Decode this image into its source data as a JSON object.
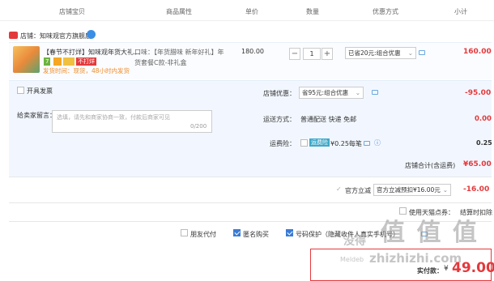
{
  "header": {
    "col_shop_item": "店铺宝贝",
    "col_attrs": "商品属性",
    "col_price": "单价",
    "col_qty": "数量",
    "col_discount": "优惠方式",
    "col_subtotal": "小计"
  },
  "shop": {
    "name": "店铺：知味观官方旗舰店"
  },
  "item": {
    "title": "【春节不打烊】知味观年货大礼...",
    "tag_7": "7",
    "tag_no_close": "不打烊",
    "ship_time": "发货时间：现货，48小时内发货",
    "attr_line1": "口味：【年货腊味 新年好礼】年",
    "attr_line2": "货套餐C款-非礼盒",
    "price": "180.00",
    "qty_minus": "−",
    "qty_value": "1",
    "qty_plus": "+",
    "discount_select": "已省20元:组合优惠",
    "subtotal": "160.00"
  },
  "panel": {
    "invoice_label": "开具发票",
    "shop_discount_label": "店铺优惠：",
    "shop_discount_select": "省95元:组合优惠",
    "shop_discount_value": "-95.00",
    "message_label": "给卖家留言：",
    "message_placeholder": "选填，请先和商家协商一致，付款后商家可见",
    "message_count": "0/200",
    "ship_label": "运送方式：",
    "ship_value": "普通配送 快递 免邮",
    "ship_cost": "0.00",
    "insure_label": "运费险：",
    "insure_tag": "运费险",
    "insure_value": "¥0.25每笔",
    "insure_cost": "0.25",
    "shop_total_label": "店铺合计(含运费)",
    "shop_total_value": "¥65.00"
  },
  "official": {
    "label": "官方立减",
    "select": "官方立减预扣¥16.00元",
    "value": "-16.00"
  },
  "tmall": {
    "label": "使用天猫点券：",
    "note": "结算时扣除"
  },
  "options": {
    "friend_pay": "朋友代付",
    "anonymous": "匿名购买",
    "privacy": "号码保护（隐藏收件人真实手机号）"
  },
  "pay": {
    "label": "实付款：",
    "currency": "¥",
    "amount": "49.00"
  },
  "watermarks": {
    "big": "值 值 值",
    "brand": "Meldeb",
    "site": "zhizhizhi.com",
    "cn": "没得"
  },
  "colors": {
    "accent_red": "#e4393c",
    "link_blue": "#3a7bd5",
    "panel_bg": "#f2f7ff"
  }
}
